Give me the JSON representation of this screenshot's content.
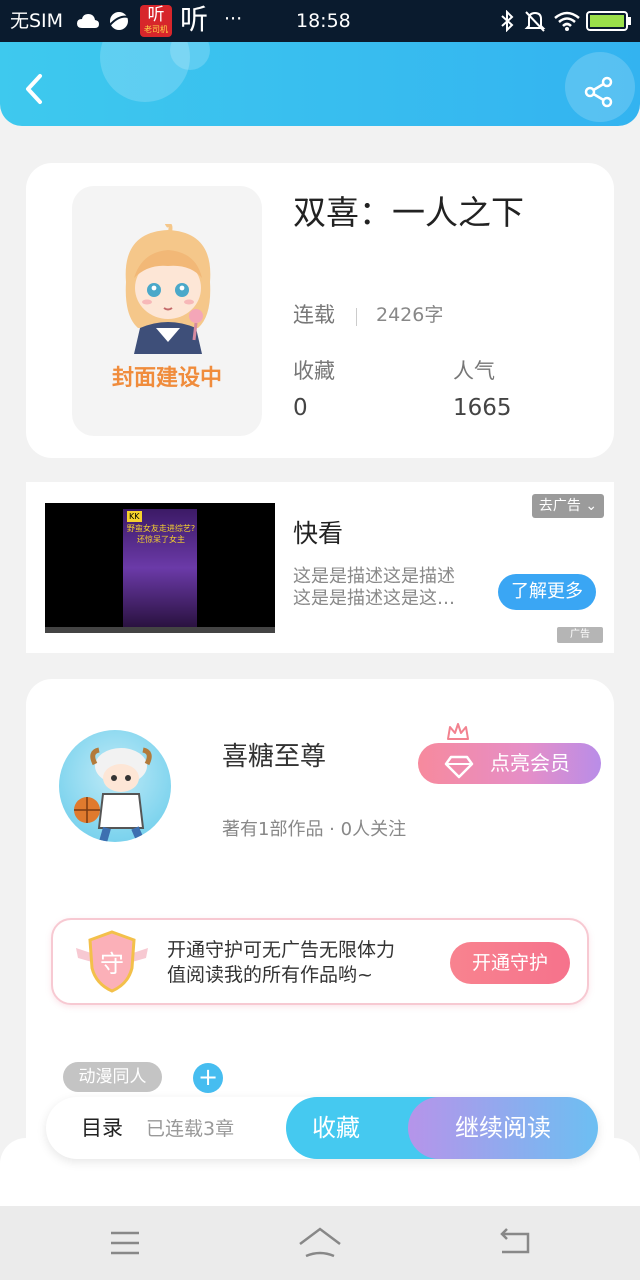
{
  "status_bar": {
    "carrier": "无SIM",
    "app_badge": "听",
    "app_badge_sub": "老司机",
    "app_icon_text": "听",
    "more": "···",
    "time": "18:58",
    "icons": [
      "cloud-icon",
      "planet-icon",
      "bluetooth-icon",
      "mute-bell-icon",
      "wifi-icon",
      "battery-icon"
    ]
  },
  "header": {
    "icons": [
      "back-icon",
      "share-icon"
    ],
    "color_start": "#3ec9ee",
    "color_end": "#33b3f0"
  },
  "book": {
    "cover_text": "封面建设中",
    "title": "双喜：一人之下",
    "status": "连载",
    "word_count": "2426字",
    "favorites_label": "收藏",
    "favorites_value": "0",
    "popularity_label": "人气",
    "popularity_value": "1665"
  },
  "ad": {
    "title": "快看",
    "description": "这是是描述这是描述这是是描述这是这…",
    "button": "了解更多",
    "remove_tag": "去广告",
    "ad_mark": "广告",
    "thumb_caption": "野蛮女友走进综艺?还惊呆了女主",
    "thumb_logo": "KK"
  },
  "author": {
    "name": "喜糖至尊",
    "stats": "著有1部作品 · 0人关注",
    "vip_button": "点亮会员"
  },
  "guard": {
    "badge": "守",
    "text_line1": "开通守护可无广告无限体力",
    "text_line2": "值阅读我的所有作品哟~",
    "button": "开通守护"
  },
  "tags": {
    "items": [
      "动漫同人"
    ],
    "add": "+"
  },
  "bottom_bar": {
    "catalog": "目录",
    "chapters": "已连载3章",
    "collect": "收藏",
    "continue": "继续阅读"
  },
  "nav_bar": {
    "icons": [
      "menu-icon",
      "home-icon",
      "return-icon"
    ]
  }
}
